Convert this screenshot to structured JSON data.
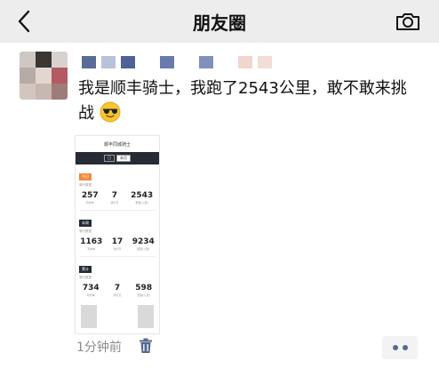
{
  "header": {
    "title": "朋友圈",
    "back_icon": "chevron-left-icon",
    "camera_icon": "camera-icon"
  },
  "post": {
    "author_avatar": "avatar",
    "text": "我是顺丰骑士，我跑了2543公里，敢不敢来挑战",
    "emoji": "sunglasses-emoji",
    "timestamp": "1分钟前"
  },
  "screenshot": {
    "title": "顺丰同城骑士",
    "tabs": [
      "日",
      "本月"
    ],
    "sections": [
      {
        "chip": "今日",
        "sub": "骑行数据",
        "stats": [
          {
            "value": "257",
            "label": "有效单"
          },
          {
            "value": "7",
            "label": "骑行天"
          },
          {
            "value": "2543",
            "label": "里程(公里)"
          }
        ]
      },
      {
        "chip": "本周",
        "sub": "骑行数据",
        "stats": [
          {
            "value": "1163",
            "label": "有效单"
          },
          {
            "value": "17",
            "label": "骑行天"
          },
          {
            "value": "9234",
            "label": "里程(公里)"
          }
        ]
      },
      {
        "chip": "累计",
        "sub": "骑行数据",
        "stats": [
          {
            "value": "734",
            "label": "有效单"
          },
          {
            "value": "7",
            "label": "骑行天"
          },
          {
            "value": "598",
            "label": "里程(公里)"
          }
        ]
      }
    ]
  },
  "actions": {
    "delete_icon": "trash-icon",
    "more_icon": "more-dots-icon"
  },
  "colors": {
    "link_blue": "#55698f",
    "timestamp_gray": "#8c8c8c",
    "topbar_bg": "#ededed"
  }
}
